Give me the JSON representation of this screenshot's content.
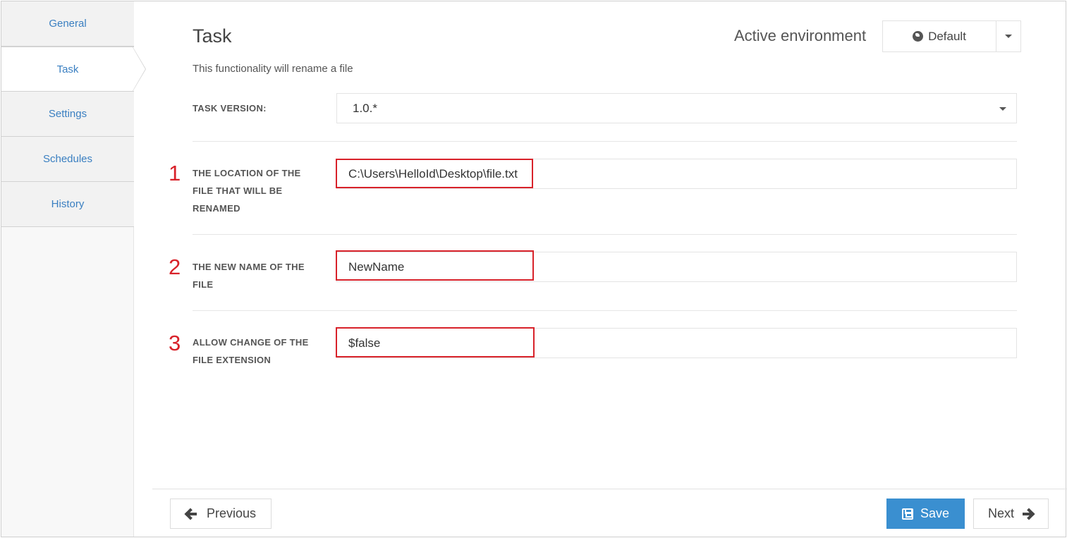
{
  "sidebar": {
    "items": [
      {
        "label": "General",
        "active": false
      },
      {
        "label": "Task",
        "active": true
      },
      {
        "label": "Settings",
        "active": false
      },
      {
        "label": "Schedules",
        "active": false
      },
      {
        "label": "History",
        "active": false
      }
    ]
  },
  "header": {
    "title": "Task",
    "subtitle": "This functionality will rename a file",
    "env_label": "Active environment",
    "env_value": "Default"
  },
  "form": {
    "task_version": {
      "label": "TASK VERSION:",
      "value": "1.0.*"
    },
    "fields": [
      {
        "number": "1",
        "label": "THE LOCATION OF THE FILE THAT WILL BE RENAMED",
        "value": "C:\\Users\\HelloId\\Desktop\\file.txt"
      },
      {
        "number": "2",
        "label": "THE NEW NAME OF THE FILE",
        "value": "NewName"
      },
      {
        "number": "3",
        "label": "ALLOW CHANGE OF THE FILE EXTENSION",
        "value": "$false"
      }
    ]
  },
  "footer": {
    "previous_label": "Previous",
    "save_label": "Save",
    "next_label": "Next"
  },
  "colors": {
    "accent": "#3a8fd0",
    "link": "#3a7fc1",
    "annotation": "#d8222a"
  },
  "icons": {
    "env": "globe-icon",
    "previous": "arrow-left-icon",
    "save": "floppy-disk-icon",
    "next": "arrow-right-icon"
  }
}
